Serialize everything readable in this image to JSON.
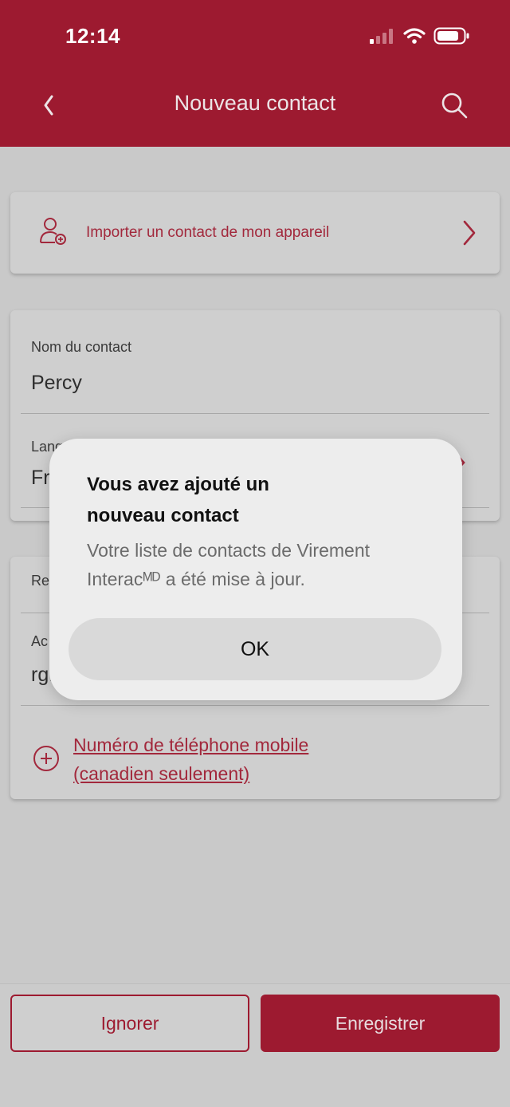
{
  "status_bar": {
    "time": "12:14"
  },
  "nav": {
    "title": "Nouveau contact"
  },
  "import": {
    "label": "Importer un contact de mon appareil"
  },
  "contact": {
    "name_label": "Nom du contact",
    "name_value": "Percy",
    "language_label_partial": "Lang",
    "language_value_partial": "Fr"
  },
  "receiving": {
    "section_label_partial": "Re",
    "address_label_partial": "Ac",
    "address_value_partial": "rg.",
    "add_mobile_link_line1": "Numéro de téléphone mobile",
    "add_mobile_link_line2": "(canadien seulement)"
  },
  "buttons": {
    "ignore": "Ignorer",
    "save": "Enregistrer"
  },
  "dialog": {
    "title_line1": "Vous avez ajouté un",
    "title_line2": "nouveau contact",
    "message_line1": "Votre liste de contacts de Virement",
    "message_line2": "Interacᴹᴰ a été mise à jour.",
    "ok": "OK"
  },
  "colors": {
    "brand": "#9d1a30",
    "overlay": "#c9c9c9"
  }
}
